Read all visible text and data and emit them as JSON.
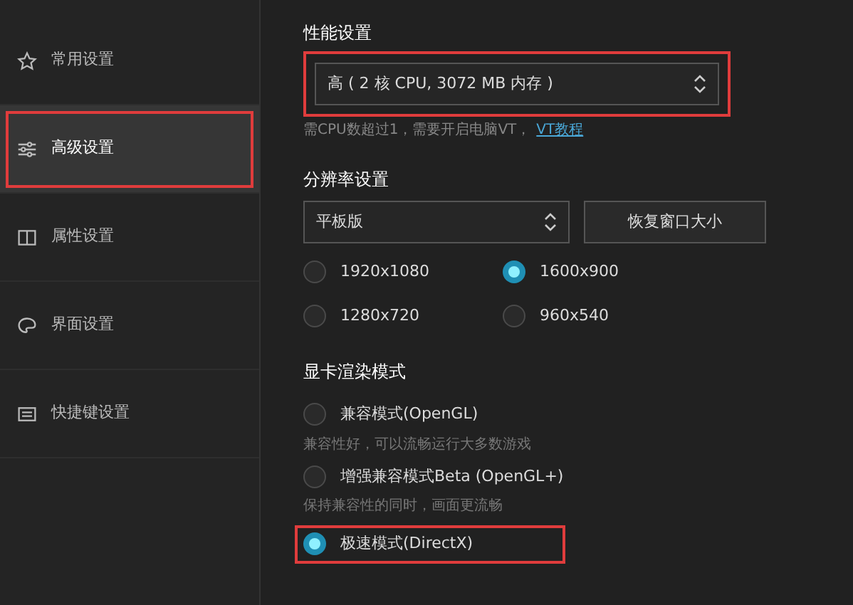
{
  "sidebar": {
    "items": [
      {
        "label": "常用设置",
        "selected": false,
        "annotated": false
      },
      {
        "label": "高级设置",
        "selected": true,
        "annotated": true
      },
      {
        "label": "属性设置",
        "selected": false,
        "annotated": false
      },
      {
        "label": "界面设置",
        "selected": false,
        "annotated": false
      },
      {
        "label": "快捷键设置",
        "selected": false,
        "annotated": false
      }
    ]
  },
  "performance": {
    "title": "性能设置",
    "value": "高 ( 2 核 CPU, 3072 MB 内存 )",
    "annotated": true,
    "hint": "需CPU数超过1，需要开启电脑VT，",
    "link": "VT教程"
  },
  "resolution": {
    "title": "分辨率设置",
    "value": "平板版",
    "button": "恢复窗口大小",
    "options": [
      {
        "label": "1920x1080",
        "selected": false
      },
      {
        "label": "1600x900",
        "selected": true
      },
      {
        "label": "1280x720",
        "selected": false
      },
      {
        "label": "960x540",
        "selected": false
      }
    ]
  },
  "render": {
    "title": "显卡渲染模式",
    "modes": [
      {
        "label": "兼容模式(OpenGL)",
        "selected": false,
        "annotated": false,
        "description": "兼容性好，可以流畅运行大多数游戏"
      },
      {
        "label": "增强兼容模式Beta (OpenGL+)",
        "selected": false,
        "annotated": false,
        "description": "保持兼容性的同时，画面更流畅"
      },
      {
        "label": "极速模式(DirectX)",
        "selected": true,
        "annotated": true
      }
    ]
  }
}
